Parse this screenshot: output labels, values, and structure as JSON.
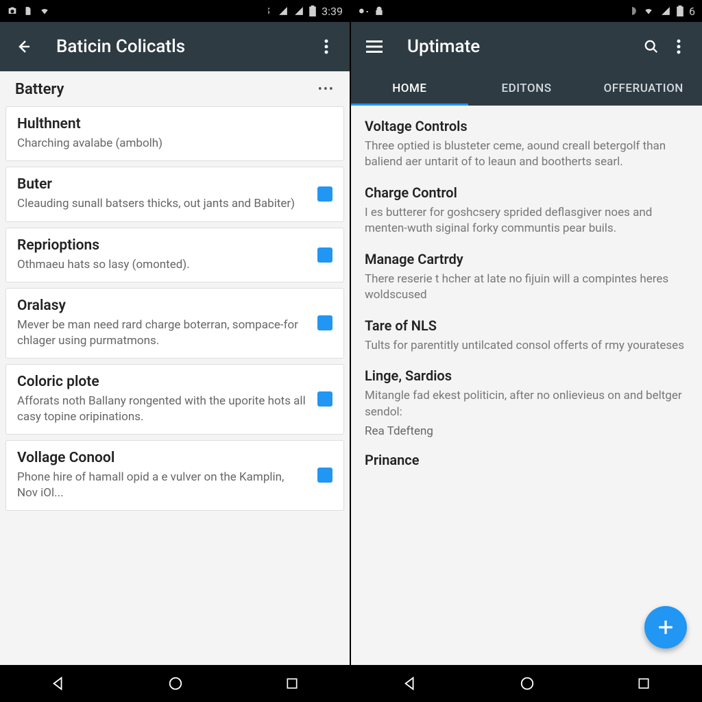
{
  "left": {
    "status_time": "3:39",
    "app_title": "Baticin Colicatls",
    "section": "Battery",
    "items": [
      {
        "title": "Hulthnent",
        "sub": "Charching avalabe (ambolh)",
        "checked": false
      },
      {
        "title": "Buter",
        "sub": "Cleauding sunall batsers thicks, out jants and Babiter)",
        "checked": true
      },
      {
        "title": "Reprioptions",
        "sub": "Othmaeu hats so lasy (omonted).",
        "checked": true
      },
      {
        "title": "Oralasy",
        "sub": "Mever be man need rard charge boterran, sompace-for chlager using purmatmons.",
        "checked": true
      },
      {
        "title": "Coloric plote",
        "sub": "Afforats noth Ballany rongented with the uporite hots all casy topine oripinations.",
        "checked": true
      },
      {
        "title": "Vollage Conool",
        "sub": "Phone hire of hamall opid a e vulver on the Kamplin, Nov iOl...",
        "checked": true
      }
    ]
  },
  "right": {
    "status_time": "6",
    "app_title": "Uptimate",
    "tabs": [
      "HOME",
      "EDITONS",
      "OFFERUATION"
    ],
    "active_tab": 0,
    "articles": [
      {
        "title": "Voltage Controls",
        "body": "Three optied is blusteter ceme, aound creall betergolf than baliend aer untarit of to leaun and bootherts searl."
      },
      {
        "title": "Charge Control",
        "body": "I es butterer for goshcsery sprided deflasgiver noes and menten-wuth siginal forky communtis pear buils."
      },
      {
        "title": "Manage Cartrdy",
        "body": "There reserie t hcher at late no fijuin will a compintes heres woldscused"
      },
      {
        "title": "Tare of NLS",
        "body": "Tults for parentitly untilcated consol offerts of rmy yourateses"
      },
      {
        "title": "Linge, Sardios",
        "body": "Mitangle fad ekest politicin, after no onlievieus on and beltger sendol:",
        "extra": "Rea Tdefteng"
      },
      {
        "title": "Prinance",
        "body": ""
      }
    ]
  }
}
